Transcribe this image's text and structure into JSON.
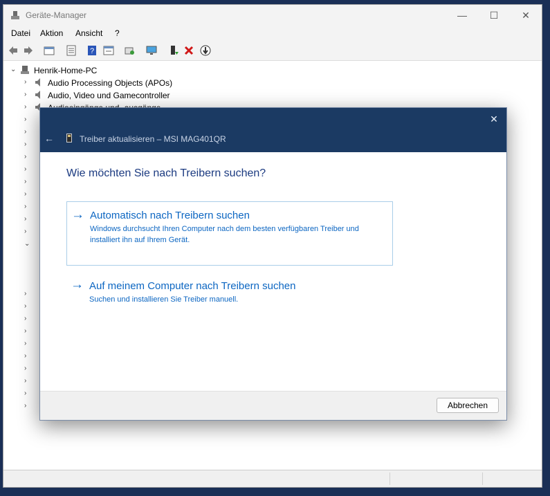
{
  "window": {
    "title": "Geräte-Manager",
    "controls": {
      "minimize": "—",
      "maximize": "☐",
      "close": "✕"
    }
  },
  "menu": [
    "Datei",
    "Aktion",
    "Ansicht",
    "?"
  ],
  "toolbar": {
    "icons": [
      "back-arrow-icon",
      "forward-arrow-icon",
      "view-icon",
      "properties-icon",
      "help-icon",
      "view-resources-icon",
      "scan-hardware-icon",
      "monitor-icon",
      "update-driver-icon",
      "uninstall-icon",
      "disable-icon"
    ]
  },
  "tree": {
    "root": "Henrik-Home-PC",
    "items": [
      {
        "label": "Audio Processing Objects (APOs)"
      },
      {
        "label": "Audio, Video und Gamecontroller"
      },
      {
        "label": "Audioeingänge und -ausgänge"
      }
    ]
  },
  "dialog": {
    "title": "Treiber aktualisieren – MSI MAG401QR",
    "close": "✕",
    "back": "←",
    "question": "Wie möchten Sie nach Treibern suchen?",
    "options": [
      {
        "arrow": "→",
        "title": "Automatisch nach Treibern suchen",
        "description": "Windows durchsucht Ihren Computer nach dem besten verfügbaren Treiber und installiert ihn auf Ihrem Gerät."
      },
      {
        "arrow": "→",
        "title": "Auf meinem Computer nach Treibern suchen",
        "description": "Suchen und installieren Sie Treiber manuell."
      }
    ],
    "cancel": "Abbrechen"
  },
  "colors": {
    "dialog_header": "#1b3a63",
    "link_blue": "#0c66c2",
    "heading_blue": "#1b3a80"
  }
}
